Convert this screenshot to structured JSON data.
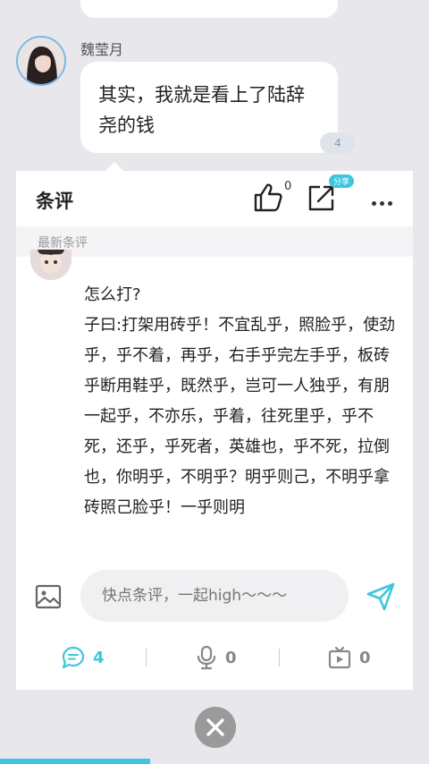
{
  "chat": {
    "sender_name": "魏莹月",
    "message_text": "其实，我就是看上了陆辞尧的钱",
    "reply_count": "4"
  },
  "panel": {
    "title": "条评",
    "like_count": "0",
    "share_tag": "分享",
    "section_label": "最新条评"
  },
  "comment": {
    "text": "怎么打?\n子曰:打架用砖乎！不宜乱乎，照脸乎，使劲乎，乎不着，再乎，右手乎完左手乎，板砖乎断用鞋乎，既然乎，岂可一人独乎，有朋一起乎，不亦乐，乎着，往死里乎，乎不死，还乎，乎死者，英雄也，乎不死，拉倒也，你明乎，不明乎？明乎则己，不明乎拿砖照己脸乎！一乎则明"
  },
  "input": {
    "placeholder": "快点条评，一起high～～～"
  },
  "tabs": [
    {
      "label": "4",
      "icon": "comment-icon",
      "active": true
    },
    {
      "label": "0",
      "icon": "microphone-icon",
      "active": false
    },
    {
      "label": "0",
      "icon": "video-icon",
      "active": false
    }
  ],
  "progress": 0.35,
  "colors": {
    "accent": "#3ec6df",
    "background": "#e8e8ec",
    "panel": "#ffffff"
  }
}
